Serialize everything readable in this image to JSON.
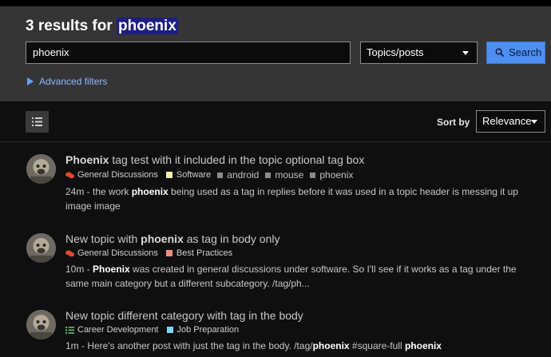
{
  "header": {
    "title_prefix": "3 results for ",
    "title_query": "phoenix",
    "search_value": "phoenix",
    "scope_select": "Topics/posts",
    "search_button": "Search",
    "advanced_filters": "Advanced filters"
  },
  "toolbar": {
    "sort_label": "Sort by",
    "sort_value": "Relevance"
  },
  "results": [
    {
      "title_bold": "Phoenix",
      "title_rest": " tag test with it included in the topic optional tag box",
      "category": "General Discussions",
      "subcategory": "Software",
      "tags": [
        "android",
        "mouse",
        "phoenix"
      ],
      "time": "24m",
      "blurb_1": " - the work ",
      "blurb_bold": "phoenix",
      "blurb_2": " being used as a tag in replies before it was used in a topic header is messing it up image image"
    },
    {
      "title_pre": "New topic with ",
      "title_bold": "phoenix",
      "title_post": " as tag in body only",
      "category": "General Discussions",
      "subcategory": "Best Practices",
      "time": "10m",
      "blurb_1": " - ",
      "blurb_bold": "Phoenix",
      "blurb_2": " was created in general discussions under software. So I'll see if it works as a tag under the same main category but a different subcategory. /tag/ph..."
    },
    {
      "title": "New topic different category with tag in the body",
      "category": "Career Development",
      "subcategory": "Job Preparation",
      "time": "1m",
      "blurb_1": " - Here's another post with just the tag in the body. /tag/",
      "blurb_bold": "phoenix",
      "blurb_2": " #square-full ",
      "blurb_bold_2": "phoenix"
    }
  ],
  "colors": {
    "header_bg": "#353536",
    "accent": "#4d8ff0",
    "highlight": "#1e1e82",
    "general_discussions": "#e8452c",
    "software": "#f3edb0",
    "best_practices": "#f28b82",
    "career_development": "#5fbf6f",
    "job_preparation": "#7fd3f0"
  },
  "icons": {
    "list_view": "list-icon",
    "search": "search-icon",
    "advanced": "triangle-right-icon"
  }
}
